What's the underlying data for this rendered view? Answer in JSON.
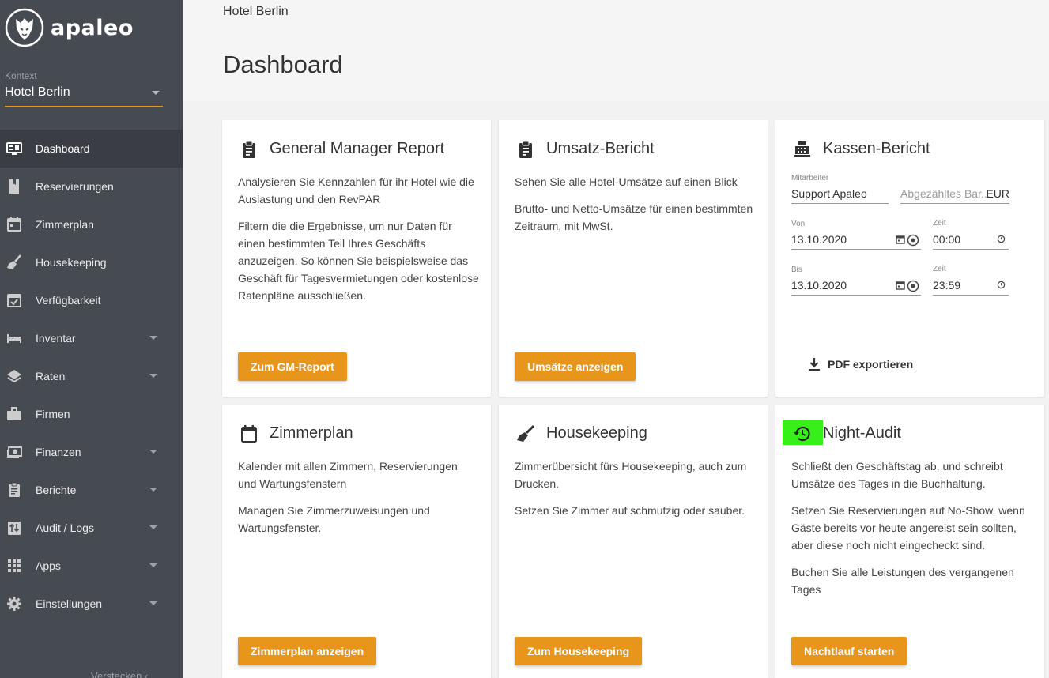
{
  "app": {
    "logo_text": "apaleo"
  },
  "sidebar": {
    "context_label": "Kontext",
    "context_value": "Hotel Berlin",
    "items": [
      {
        "label": "Dashboard",
        "icon": "dashboard-icon",
        "active": true,
        "expandable": false
      },
      {
        "label": "Reservierungen",
        "icon": "book-icon",
        "expandable": false
      },
      {
        "label": "Zimmerplan",
        "icon": "calendar-icon",
        "expandable": false
      },
      {
        "label": "Housekeeping",
        "icon": "broom-icon",
        "expandable": false
      },
      {
        "label": "Verfügbarkeit",
        "icon": "event-available-icon",
        "expandable": false
      },
      {
        "label": "Inventar",
        "icon": "bed-icon",
        "expandable": true
      },
      {
        "label": "Raten",
        "icon": "layers-icon",
        "expandable": true
      },
      {
        "label": "Firmen",
        "icon": "briefcase-icon",
        "expandable": false
      },
      {
        "label": "Finanzen",
        "icon": "money-icon",
        "expandable": true
      },
      {
        "label": "Berichte",
        "icon": "clipboard-icon",
        "expandable": true
      },
      {
        "label": "Audit / Logs",
        "icon": "swap-vert-icon",
        "expandable": true
      },
      {
        "label": "Apps",
        "icon": "apps-grid-icon",
        "expandable": true
      },
      {
        "label": "Einstellungen",
        "icon": "gear-icon",
        "expandable": true
      }
    ],
    "hide_label": "Verstecken"
  },
  "header": {
    "breadcrumb": "Hotel Berlin",
    "title": "Dashboard"
  },
  "cards": {
    "gm": {
      "title": "General Manager Report",
      "p1": "Analysieren Sie Kennzahlen für ihr Hotel wie die Auslastung und den RevPAR",
      "p2": "Filtern die die Ergebnisse, um nur Daten für einen bestimmten Teil Ihres Geschäfts anzuzeigen. So können Sie beispielsweise das Geschäft für Tagesvermietungen oder kostenlose Ratenpläne ausschließen.",
      "button": "Zum GM-Report"
    },
    "revenue": {
      "title": "Umsatz-Bericht",
      "p1": "Sehen Sie alle Hotel-Umsätze auf einen Blick",
      "p2": "Brutto- und Netto-Umsätze für einen bestimmten Zeitraum, mit MwSt.",
      "button": "Umsätze anzeigen"
    },
    "cash": {
      "title": "Kassen-Bericht",
      "employee_label": "Mitarbeiter",
      "employee_value": "Support Apaleo",
      "counted_placeholder": "Abgezähltes Bar...",
      "currency": "EUR",
      "from_label": "Von",
      "from_date": "13.10.2020",
      "from_time_label": "Zeit",
      "from_time": "00:00",
      "to_label": "Bis",
      "to_date": "13.10.2020",
      "to_time_label": "Zeit",
      "to_time": "23:59",
      "export": "PDF exportieren"
    },
    "roomplan": {
      "title": "Zimmerplan",
      "p1": "Kalender mit allen Zimmern, Reservierungen und Wartungsfenstern",
      "p2": "Managen Sie Zimmerzuweisungen und Wartungsfenster.",
      "button": "Zimmerplan anzeigen"
    },
    "housekeeping": {
      "title": "Housekeeping",
      "p1": "Zimmerübersicht fürs Housekeeping, auch zum Drucken.",
      "p2": "Setzen Sie Zimmer auf schmutzig oder sauber.",
      "button": "Zum Housekeeping"
    },
    "nightaudit": {
      "title": "Night-Audit",
      "p1": "Schließt den Geschäftstag ab, und schreibt Umsätze des Tages in die Buchhaltung.",
      "p2": "Setzen Sie Reservierungen auf No-Show, wenn Gäste bereits vor heute angereist sein sollten, aber diese noch nicht eingecheckt sind.",
      "p3": "Buchen Sie alle Leistungen des vergangenen Tages",
      "button": "Nachtlauf starten",
      "highlight_color": "#37f01a"
    }
  },
  "colors": {
    "accent": "#e8951c",
    "sidebar_bg": "#464a51",
    "sidebar_active": "#3a3e44"
  }
}
